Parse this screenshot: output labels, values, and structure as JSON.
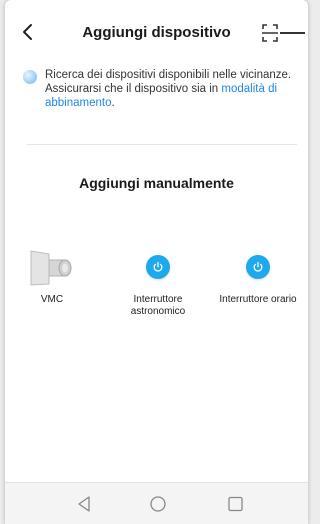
{
  "header": {
    "title": "Aggiungi dispositivo",
    "back_icon": "chevron-left-icon",
    "scan_icon": "scan-frame-icon"
  },
  "search": {
    "text": "Ricerca dei dispositivi disponibili nelle vicinanze. Assicurarsi che il dispositivo sia in ",
    "link": "modalità di abbinamento",
    "suffix": "."
  },
  "manual": {
    "title": "Aggiungi manualmente",
    "devices": [
      {
        "label": "VMC",
        "icon": "vmc-fan-icon"
      },
      {
        "label": "Interruttore astronomico",
        "icon": "power-icon"
      },
      {
        "label": "Interruttore orario",
        "icon": "power-icon"
      }
    ]
  },
  "navbar": {
    "back": "triangle-back-icon",
    "home": "circle-home-icon",
    "recents": "square-recents-icon"
  },
  "colors": {
    "accent": "#1ea9ee",
    "link": "#1e88e5"
  }
}
